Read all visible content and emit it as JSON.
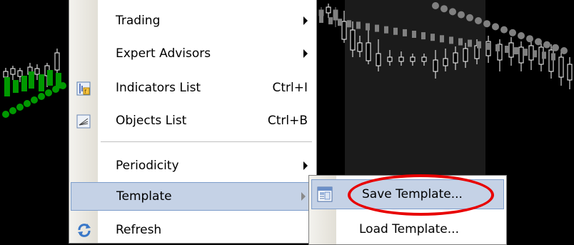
{
  "context_menu": {
    "items": [
      {
        "label": "Trading",
        "has_submenu": true
      },
      {
        "label": "Expert Advisors",
        "has_submenu": true
      },
      {
        "label": "Indicators List",
        "shortcut": "Ctrl+I",
        "icon": "indicators-list-icon"
      },
      {
        "label": "Objects List",
        "shortcut": "Ctrl+B",
        "icon": "objects-list-icon"
      },
      {
        "label": "Periodicity",
        "has_submenu": true
      },
      {
        "label": "Template",
        "has_submenu": true,
        "highlighted": true
      },
      {
        "label": "Refresh",
        "icon": "refresh-icon"
      }
    ]
  },
  "template_submenu": {
    "items": [
      {
        "label": "Save Template...",
        "icon": "save-template-icon",
        "highlighted": true
      },
      {
        "label": "Load Template..."
      }
    ]
  },
  "colors": {
    "chart_background": "#000000",
    "chart_panel": "#1c1c1c",
    "candles_gray": "#808080",
    "candles_white": "#ffffff",
    "indicator_green": "#009900",
    "menu_highlight": "#c5d2e6",
    "annotation_red": "#e80000"
  }
}
